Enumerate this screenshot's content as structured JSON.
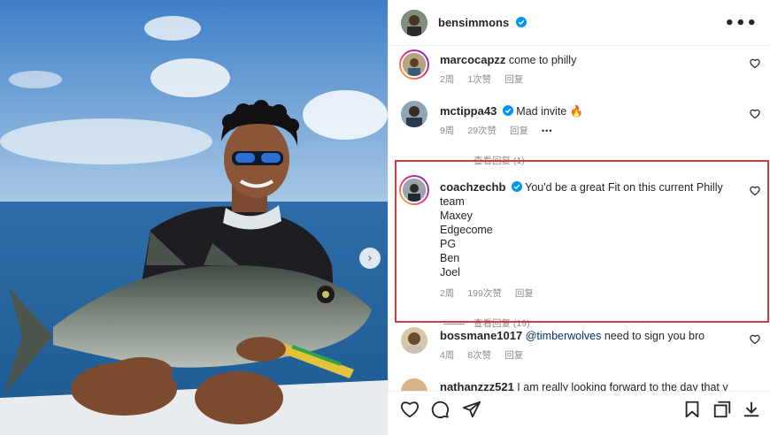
{
  "post": {
    "username": "bensimmons",
    "more_label": "•••"
  },
  "comments": [
    {
      "username": "marcocapzz",
      "text": "come to philly",
      "age": "2周",
      "likes": "1次赞",
      "reply_label": "回复"
    },
    {
      "username": "mctippa43",
      "text": "Mad invite 🔥",
      "age": "9周",
      "likes": "29次赞",
      "reply_label": "回复",
      "options_label": "•••",
      "view_replies": "查看回复 (1)"
    },
    {
      "username": "coachzechb",
      "text": "You'd be a great Fit on this current Philly team",
      "lines": [
        "Maxey",
        "Edgecome",
        "PG",
        "Ben",
        "Joel"
      ],
      "age": "2周",
      "likes": "199次赞",
      "reply_label": "回复",
      "view_replies": "查看回复 (19)"
    },
    {
      "username": "bossmane1017",
      "mention": "@timberwolves",
      "text": "need to sign you bro",
      "age": "4周",
      "likes": "8次赞",
      "reply_label": "回复"
    },
    {
      "username": "nathanzzz521",
      "text": "I am really looking forward to the day that y"
    }
  ],
  "icons": [
    "heart-icon",
    "comment-icon",
    "share-icon",
    "bookmark-icon",
    "collection-icon",
    "download-icon",
    "verified-badge-icon",
    "chevron-right-icon"
  ],
  "colors": {
    "highlight": "#d9383e",
    "verified": "#0095f6",
    "muted": "#8e8e8e"
  }
}
